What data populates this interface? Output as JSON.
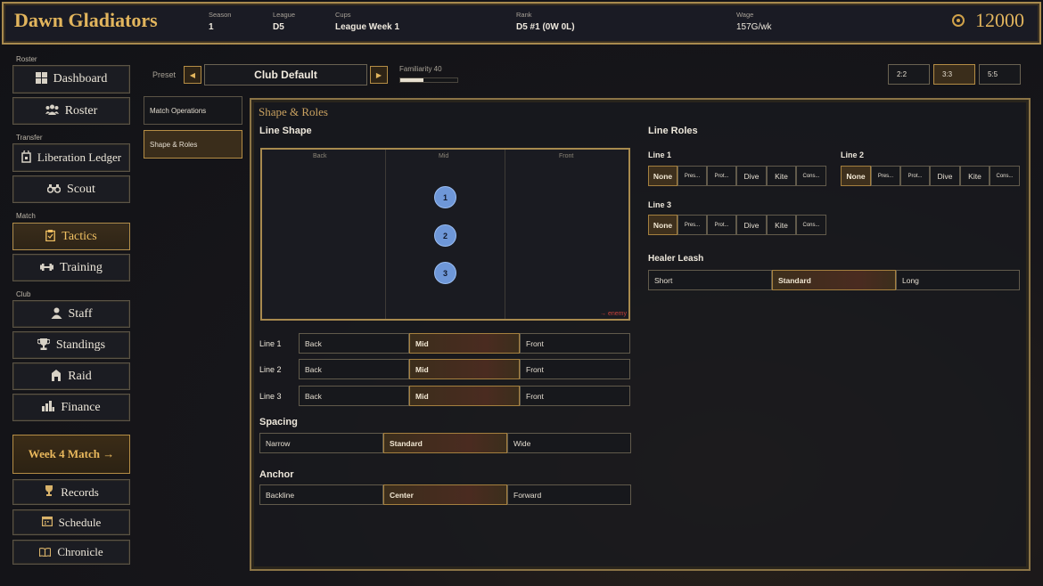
{
  "header": {
    "team_name": "Dawn Gladiators",
    "season": {
      "label": "Season",
      "value": "1"
    },
    "league": {
      "label": "League",
      "value": "D5"
    },
    "cups": {
      "label": "Cups",
      "value": "League Week 1"
    },
    "rank": {
      "label": "Rank",
      "value": "D5 #1 (0W 0L)"
    },
    "wage": {
      "label": "Wage",
      "value": "157G/wk"
    },
    "gold": "12000"
  },
  "sidebar": {
    "sections": {
      "roster": "Roster",
      "transfer": "Transfer",
      "match": "Match",
      "club": "Club"
    },
    "items": [
      {
        "label": "Dashboard",
        "icon": "dashboard-icon"
      },
      {
        "label": "Roster",
        "icon": "roster-icon"
      },
      {
        "label": "Liberation Ledger",
        "icon": "ledger-icon"
      },
      {
        "label": "Scout",
        "icon": "binoculars-icon"
      },
      {
        "label": "Tactics",
        "icon": "clipboard-icon"
      },
      {
        "label": "Training",
        "icon": "dumbbell-icon"
      },
      {
        "label": "Staff",
        "icon": "staff-icon"
      },
      {
        "label": "Standings",
        "icon": "trophy-icon"
      },
      {
        "label": "Raid",
        "icon": "raid-icon"
      },
      {
        "label": "Finance",
        "icon": "finance-icon"
      }
    ],
    "week_match": "Week 4 Match →",
    "extra": [
      {
        "label": "Records",
        "icon": "cup-icon"
      },
      {
        "label": "Schedule",
        "icon": "calendar-icon"
      },
      {
        "label": "Chronicle",
        "icon": "book-icon"
      }
    ]
  },
  "preset": {
    "label": "Preset",
    "name": "Club Default",
    "familiarity_label": "Familiarity 40",
    "familiarity": 40
  },
  "formation_sizes": [
    "2:2",
    "3:3",
    "5:5"
  ],
  "subnav": [
    "Match Operations",
    "Shape & Roles"
  ],
  "panel": {
    "title": "Shape & Roles",
    "line_shape": {
      "heading": "Line Shape",
      "zones": [
        "Back",
        "Mid",
        "Front"
      ],
      "units": [
        "1",
        "2",
        "3"
      ],
      "enemy": "→ enemy"
    },
    "lines": [
      {
        "label": "Line 1",
        "options": [
          "Back",
          "Mid",
          "Front"
        ],
        "selected": "Mid"
      },
      {
        "label": "Line 2",
        "options": [
          "Back",
          "Mid",
          "Front"
        ],
        "selected": "Mid"
      },
      {
        "label": "Line 3",
        "options": [
          "Back",
          "Mid",
          "Front"
        ],
        "selected": "Mid"
      }
    ],
    "spacing": {
      "heading": "Spacing",
      "options": [
        "Narrow",
        "Standard",
        "Wide"
      ],
      "selected": "Standard"
    },
    "anchor": {
      "heading": "Anchor",
      "options": [
        "Backline",
        "Center",
        "Forward"
      ],
      "selected": "Center"
    },
    "line_roles": {
      "heading": "Line Roles",
      "lines": [
        {
          "label": "Line 1",
          "options": [
            "None",
            "Pres...",
            "Prot...",
            "Dive",
            "Kite",
            "Cons..."
          ],
          "selected": "None"
        },
        {
          "label": "Line 2",
          "options": [
            "None",
            "Pres...",
            "Prot...",
            "Dive",
            "Kite",
            "Cons..."
          ],
          "selected": "None"
        },
        {
          "label": "Line 3",
          "options": [
            "None",
            "Pres...",
            "Prot...",
            "Dive",
            "Kite",
            "Cons..."
          ],
          "selected": "None"
        }
      ]
    },
    "healer_leash": {
      "heading": "Healer Leash",
      "options": [
        "Short",
        "Standard",
        "Long"
      ],
      "selected": "Standard"
    }
  }
}
